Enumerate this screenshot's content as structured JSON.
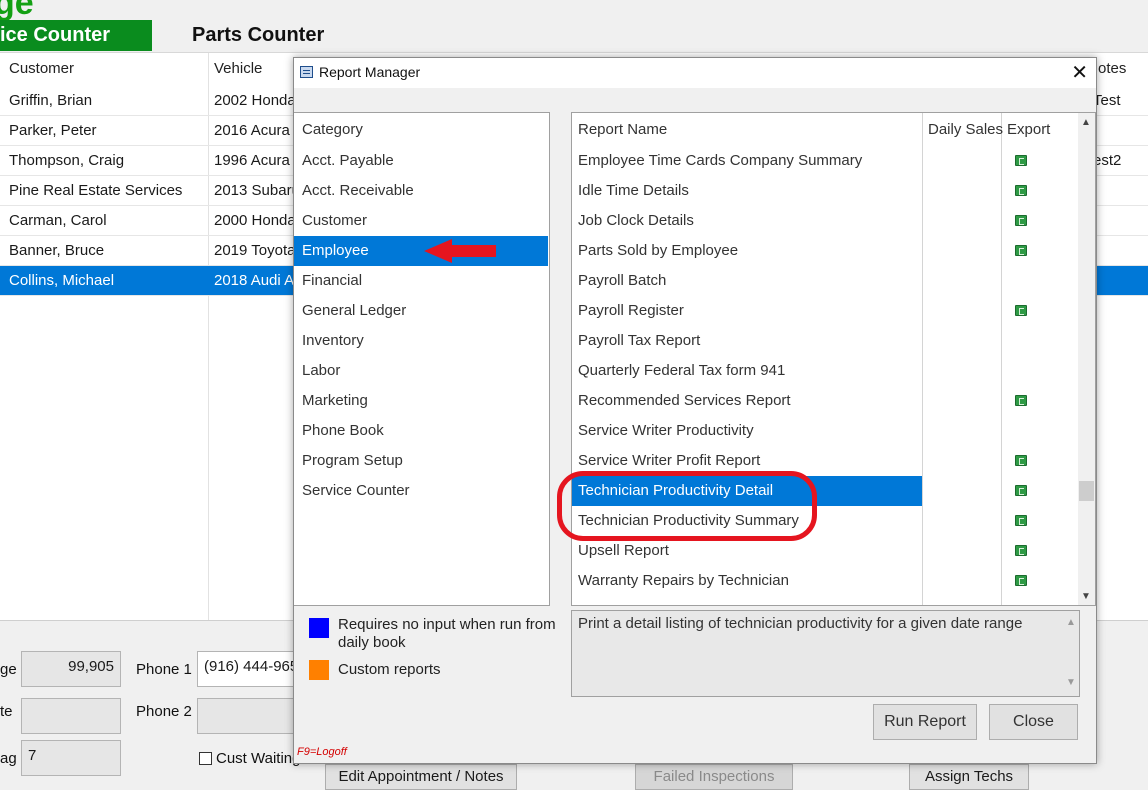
{
  "background": {
    "logo_fragment": "ge",
    "tabs": {
      "service_counter": "ice Counter",
      "parts_counter": "Parts Counter"
    },
    "grid": {
      "headers": [
        "Customer",
        "Vehicle",
        "otes"
      ],
      "rows": [
        {
          "customer": "Griffin, Brian",
          "vehicle": "2002 Honda",
          "notes": "Test"
        },
        {
          "customer": "Parker, Peter",
          "vehicle": "2016 Acura",
          "notes": ""
        },
        {
          "customer": "Thompson, Craig",
          "vehicle": "1996 Acura",
          "notes": "est2"
        },
        {
          "customer": "Pine Real Estate Services",
          "vehicle": "2013 Subaru",
          "notes": ""
        },
        {
          "customer": "Carman, Carol",
          "vehicle": "2000 Honda",
          "notes": ""
        },
        {
          "customer": "Banner, Bruce",
          "vehicle": "2019 Toyota",
          "notes": ""
        },
        {
          "customer": "Collins, Michael",
          "vehicle": "2018 Audi  A",
          "notes": ""
        }
      ]
    },
    "bottom": {
      "label_1": "ge",
      "mileage_value": "99,905",
      "label_2": "te",
      "label_3": "ag",
      "tag_value": "7",
      "phone1_label": "Phone 1",
      "phone1_value": "(916) 444-965",
      "phone2_label": "Phone 2",
      "cust_waiting_label": "Cust Waiting",
      "edit_appt_button": "Edit Appointment / Notes",
      "failed_inspections_button": "Failed Inspections",
      "assign_techs_button": "Assign Techs"
    }
  },
  "dialog": {
    "title": "Report Manager",
    "close_glyph": "✕",
    "category_header": "Category",
    "categories": [
      "Acct. Payable",
      "Acct. Receivable",
      "Customer",
      "Employee",
      "Financial",
      "General Ledger",
      "Inventory",
      "Labor",
      "Marketing",
      "Phone Book",
      "Program Setup",
      "Service Counter"
    ],
    "selected_category": "Employee",
    "report_headers": {
      "name": "Report Name",
      "daily_sales": "Daily Sales",
      "export": "Export"
    },
    "reports": [
      {
        "name": "Employee Time Cards Company Summary",
        "export": true
      },
      {
        "name": "Idle Time Details",
        "export": true
      },
      {
        "name": "Job Clock Details",
        "export": true
      },
      {
        "name": "Parts Sold by Employee",
        "export": true
      },
      {
        "name": "Payroll Batch",
        "export": false
      },
      {
        "name": "Payroll Register",
        "export": true
      },
      {
        "name": "Payroll Tax Report",
        "export": false
      },
      {
        "name": "Quarterly Federal Tax form 941",
        "export": false
      },
      {
        "name": "Recommended Services Report",
        "export": true
      },
      {
        "name": "Service Writer Productivity",
        "export": false
      },
      {
        "name": "Service Writer Profit Report",
        "export": true
      },
      {
        "name": "Technician Productivity Detail",
        "export": true
      },
      {
        "name": "Technician Productivity Summary",
        "export": true
      },
      {
        "name": "Upsell Report",
        "export": true
      },
      {
        "name": "Warranty Repairs by Technician",
        "export": true
      }
    ],
    "selected_report": "Technician Productivity Detail",
    "legend": {
      "blue_label": "Requires no input when run from daily book",
      "orange_label": "Custom reports",
      "blue_color": "#0000ff",
      "orange_color": "#ff8000"
    },
    "description": "Print a detail listing of technician productivity for a given date range",
    "run_report_button": "Run Report",
    "close_button": "Close",
    "logoff_hint": "F9=Logoff"
  },
  "colors": {
    "selection": "#0078d7",
    "annotation_red": "#e5151f",
    "tab_green": "#0a8c1e"
  }
}
